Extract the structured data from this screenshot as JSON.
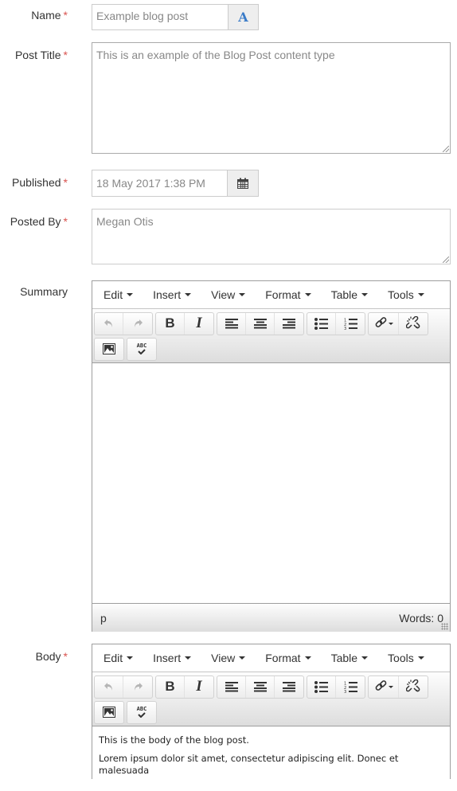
{
  "fields": {
    "name": {
      "label": "Name",
      "required_mark": "*",
      "value": "Example blog post",
      "addon_icon": "font-A-icon",
      "addon_glyph": "A"
    },
    "post_title": {
      "label": "Post Title",
      "required_mark": "*",
      "value": "This is an example of the Blog Post content type"
    },
    "published": {
      "label": "Published",
      "required_mark": "*",
      "value": "18 May 2017 1:38 PM",
      "addon_icon": "calendar-icon"
    },
    "posted_by": {
      "label": "Posted By",
      "required_mark": "*",
      "value": "Megan Otis"
    },
    "summary": {
      "label": "Summary"
    },
    "body": {
      "label": "Body",
      "required_mark": "*"
    }
  },
  "editor": {
    "menus": [
      "Edit",
      "Insert",
      "View",
      "Format",
      "Table",
      "Tools"
    ],
    "toolbar_icons": [
      "undo-icon",
      "redo-icon",
      "bold-icon",
      "italic-icon",
      "align-left-icon",
      "align-center-icon",
      "align-right-icon",
      "bullet-list-icon",
      "numbered-list-icon",
      "link-icon",
      "unlink-icon",
      "image-icon",
      "spellcheck-icon"
    ],
    "bold_glyph": "B",
    "italic_glyph": "I",
    "spellcheck_text": "ABC"
  },
  "summary_editor": {
    "status_path": "p",
    "word_count": "Words: 0"
  },
  "body_editor": {
    "paragraphs": [
      "This is the body of the blog post.",
      "Lorem ipsum dolor sit amet, consectetur adipiscing elit. Donec et malesuada"
    ]
  },
  "colors": {
    "required": "#d9534f",
    "addon_icon": "#3a7bc8"
  }
}
